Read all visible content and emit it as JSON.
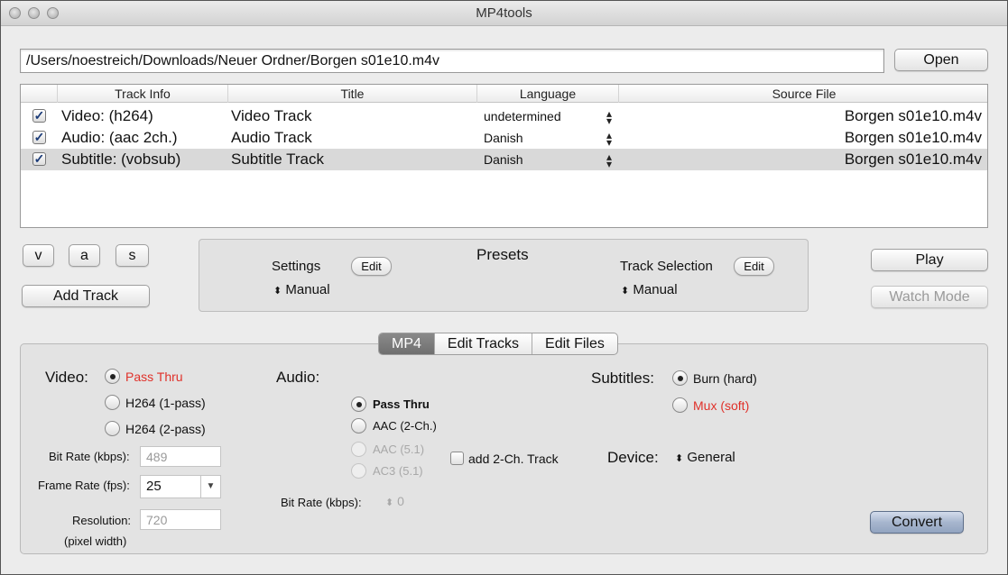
{
  "window": {
    "title": "MP4tools"
  },
  "file": {
    "path": "/Users/noestreich/Downloads/Neuer Ordner/Borgen s01e10.m4v",
    "open_label": "Open"
  },
  "table": {
    "headers": [
      "Track Info",
      "Title",
      "Language",
      "Source File"
    ],
    "rows": [
      {
        "checked": "✓",
        "info": "Video: (h264)",
        "title": "Video Track",
        "language": "undetermined",
        "source": "Borgen s01e10.m4v"
      },
      {
        "checked": "✓",
        "info": "Audio: (aac 2ch.)",
        "title": "Audio Track",
        "language": "Danish",
        "source": "Borgen s01e10.m4v"
      },
      {
        "checked": "✓",
        "info": "Subtitle: (vobsub)",
        "title": "Subtitle Track",
        "language": "Danish",
        "source": "Borgen s01e10.m4v"
      }
    ]
  },
  "track_buttons": {
    "v": "v",
    "a": "a",
    "s": "s",
    "add_track": "Add Track"
  },
  "presets": {
    "title": "Presets",
    "settings_label": "Settings",
    "settings_edit": "Edit",
    "settings_value": "Manual",
    "track_selection_label": "Track Selection",
    "track_selection_edit": "Edit",
    "track_selection_value": "Manual"
  },
  "right_buttons": {
    "play": "Play",
    "watch_mode": "Watch Mode"
  },
  "tabs": [
    "MP4",
    "Edit Tracks",
    "Edit Files"
  ],
  "video": {
    "label": "Video:",
    "options": [
      "Pass Thru",
      "H264 (1-pass)",
      "H264 (2-pass)"
    ],
    "bitrate_label": "Bit Rate (kbps):",
    "bitrate_value": "489",
    "framerate_label": "Frame Rate (fps):",
    "framerate_value": "25",
    "resolution_label": "Resolution:",
    "resolution_value": "720",
    "resolution_note": "(pixel width)"
  },
  "audio": {
    "label": "Audio:",
    "options": [
      "Pass Thru",
      "AAC (2-Ch.)",
      "AAC (5.1)",
      "AC3 (5.1)"
    ],
    "add_track_label": "add 2-Ch. Track",
    "bitrate_label": "Bit Rate (kbps):",
    "bitrate_value": "0"
  },
  "subtitles": {
    "label": "Subtitles:",
    "options": [
      "Burn (hard)",
      "Mux (soft)"
    ]
  },
  "device": {
    "label": "Device:",
    "value": "General"
  },
  "convert_label": "Convert",
  "colors": {
    "accent_red": "#e0312a",
    "selection": "#d9d9d9",
    "active_tab": "#7a7a7a"
  }
}
